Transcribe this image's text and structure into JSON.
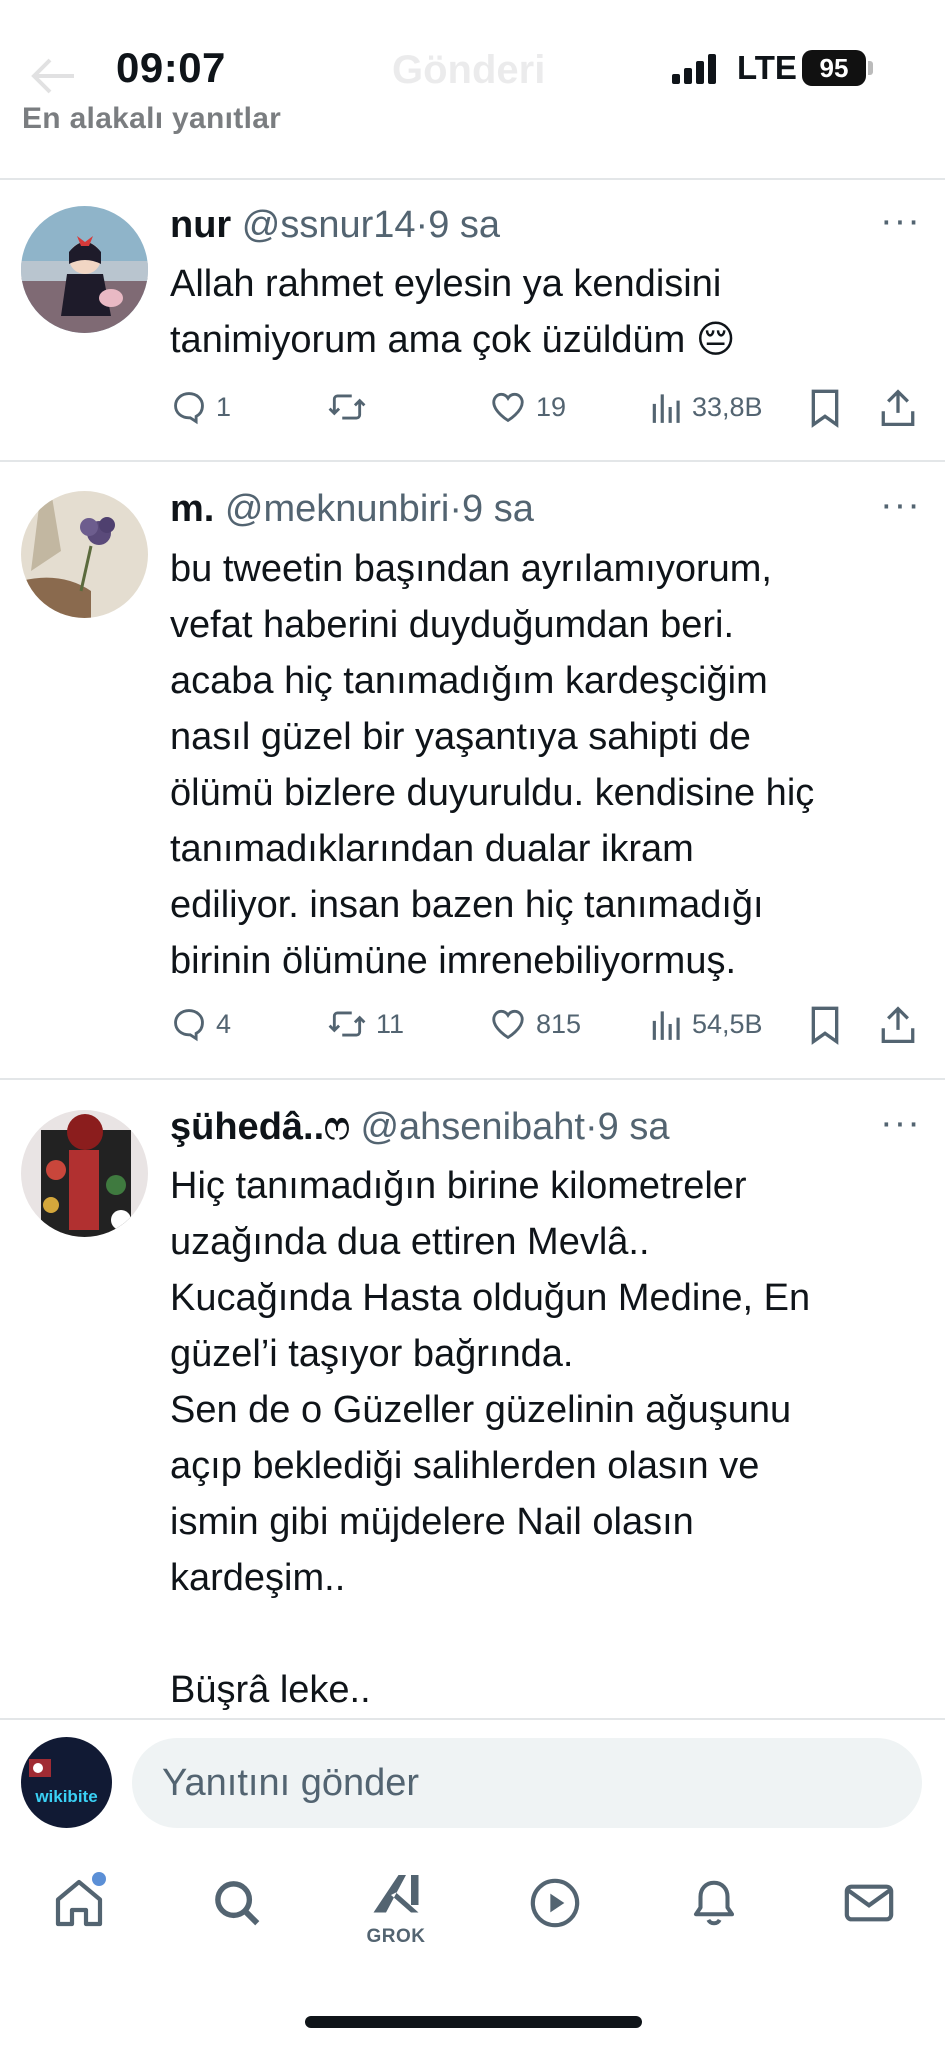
{
  "status_bar": {
    "time": "09:07",
    "network": "LTE",
    "battery": "95"
  },
  "header": {
    "title": "Gönderi",
    "sort_label": "En alakalı yanıtlar"
  },
  "tweets": [
    {
      "name": "nur",
      "handle": "@ssnur14",
      "time": "9 sa",
      "text": "Allah rahmet eylesin ya kendisini\ntanimiyorum ama çok üzüldüm 😔",
      "replies": "1",
      "reposts": "",
      "likes": "19",
      "views": "33,8B"
    },
    {
      "name": "m.",
      "handle": "@meknunbiri",
      "time": "9 sa",
      "text": "bu tweetin başından ayrılamıyorum,\nvefat haberini duyduğumdan beri.\nacaba hiç tanımadığım kardeşciğim\nnasıl güzel bir yaşantıya sahipti de\nölümü bizlere duyuruldu. kendisine hiç\ntanımadıklarından dualar ikram\nediliyor. insan bazen hiç tanımadığı\nbirinin ölümüne imrenebiliyormuş.",
      "replies": "4",
      "reposts": "11",
      "likes": "815",
      "views": "54,5B"
    },
    {
      "name": "şühedâ..ෆ",
      "handle": "@ahsenibaht",
      "time": "9 sa",
      "text": "Hiç tanımadığın birine kilometreler\nuzağında dua ettiren Mevlâ..\nKucağında Hasta olduğun Medine, En\ngüzel’i taşıyor bağrında.\nSen de o Güzeller güzelinin ağuşunu\naçıp beklediği salihlerden olasın ve\nismin gibi müjdelere Nail olasın\nkardeşim..\n\nBüşrâ leke.."
    }
  ],
  "meta_separator": "·",
  "more_label": "···",
  "reply_bar": {
    "placeholder": "Yanıtını gönder",
    "avatar_text": "wikibite"
  },
  "nav": {
    "grok_label": "GROK"
  },
  "colors": {
    "text": "#0f1419",
    "secondary": "#536471",
    "divider": "#e3e6e8",
    "accent": "#1d9bf0"
  },
  "icons": [
    "reply-icon",
    "repost-icon",
    "like-icon",
    "views-icon",
    "bookmark-icon",
    "share-icon",
    "home-icon",
    "search-icon",
    "grok-icon",
    "video-icon",
    "bell-icon",
    "mail-icon"
  ]
}
